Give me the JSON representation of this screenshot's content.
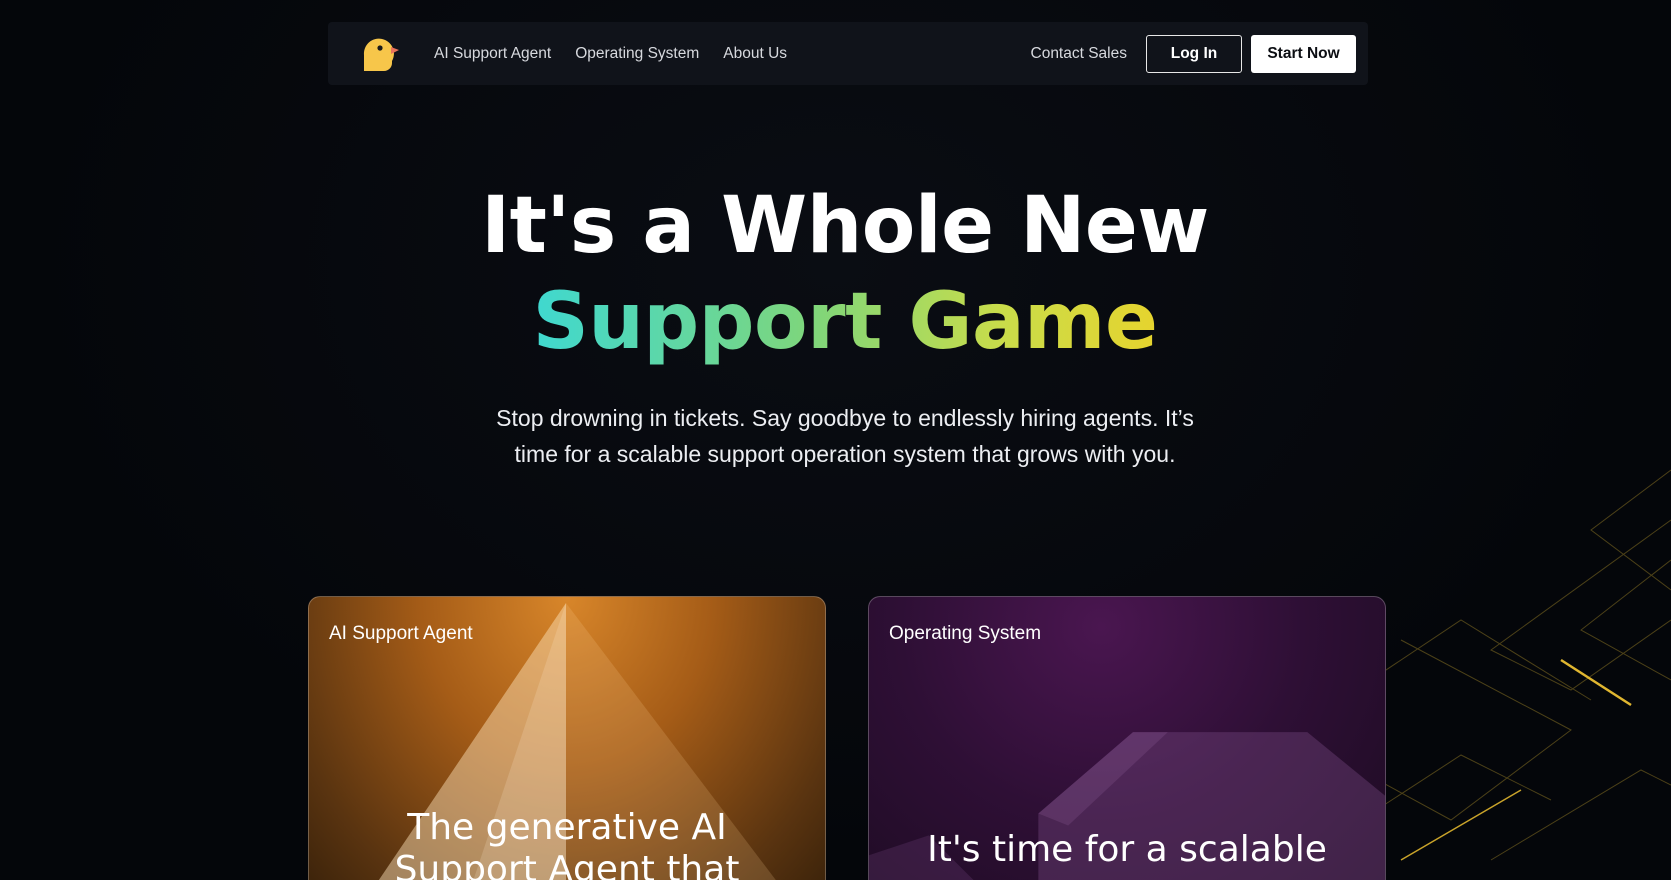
{
  "nav": {
    "logo_icon": "duck-logo-icon",
    "links": [
      "AI Support Agent",
      "Operating System",
      "About Us"
    ],
    "contact": "Contact Sales",
    "login": "Log In",
    "start": "Start Now"
  },
  "hero": {
    "line1": "It's a Whole New",
    "line2": "Support Game",
    "subtitle": "Stop drowning in tickets. Say goodbye to endlessly hiring agents. It’s time for a scalable support operation system that grows with you."
  },
  "cards": [
    {
      "label": "AI Support Agent",
      "text": "The generative AI Support Agent that"
    },
    {
      "label": "Operating System",
      "text": "It's time for a scalable"
    }
  ],
  "colors": {
    "background": "#05070b",
    "nav_bg": "#10131a",
    "gradient_start": "#3fd8d0",
    "gradient_end": "#e6d42e",
    "card_agent": "#d8862a",
    "card_os": "#4a1650"
  }
}
